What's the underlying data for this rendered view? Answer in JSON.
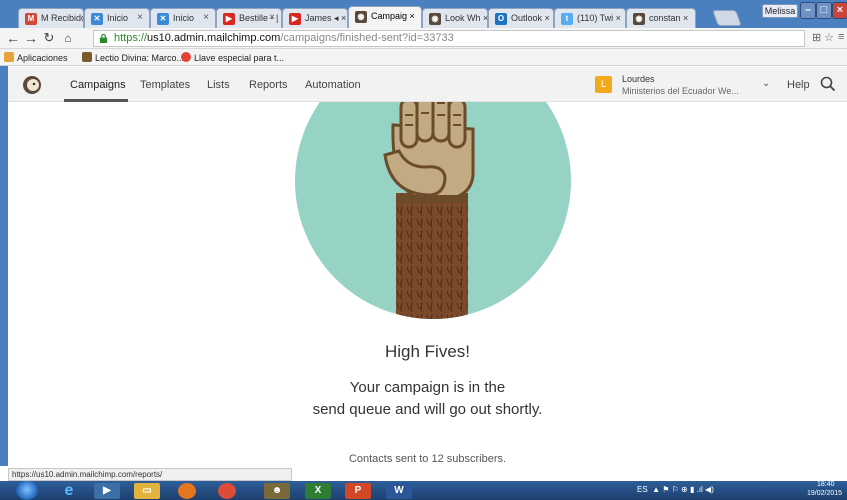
{
  "browser": {
    "tabs": [
      {
        "label": "M Recibidos ×",
        "fav": "M",
        "color": "#d44638"
      },
      {
        "label": "Inicio",
        "fav": "✕",
        "color": "#3b8ad9"
      },
      {
        "label": "Inicio",
        "fav": "✕",
        "color": "#3b8ad9"
      },
      {
        "label": "Bestille - |",
        "fav": "▶",
        "color": "#d8271c"
      },
      {
        "label": "James ◂ ×",
        "fav": "▶",
        "color": "#d8271c"
      },
      {
        "label": "Campaig ×",
        "fav": "◉",
        "color": "#5b4a3b"
      },
      {
        "label": "Look Wh ×",
        "fav": "◉",
        "color": "#5b4a3b"
      },
      {
        "label": "Outlook ×",
        "fav": "O",
        "color": "#1e73be"
      },
      {
        "label": "(110) Twi ×",
        "fav": "t",
        "color": "#55acee"
      },
      {
        "label": "constan ×",
        "fav": "◉",
        "color": "#5b4a3b"
      }
    ],
    "user_chip": "Melissa",
    "url": {
      "scheme": "https://",
      "host": "us10.admin.mailchimp.com",
      "path": "/campaigns/finished-sent?id=33733"
    },
    "bookmarks": [
      {
        "label": "Aplicaciones",
        "color": "#e8a23a"
      },
      {
        "label": "Lectio Divina: Marco...",
        "color": "#7b5b2d"
      },
      {
        "label": "Llave especial para t...",
        "color": "#e34234"
      }
    ],
    "status_url": "https://us10.admin.mailchimp.com/reports/"
  },
  "nav": {
    "items": [
      "Campaigns",
      "Templates",
      "Lists",
      "Reports",
      "Automation"
    ],
    "account_initial": "L",
    "account_name": "Lourdes",
    "account_org": "Ministerios del Ecuador We...",
    "help": "Help"
  },
  "content": {
    "title": "High Fives!",
    "message_line1": "Your campaign is in the",
    "message_line2": "send queue and will go out shortly.",
    "contacts": "Contacts sent to 12 subscribers."
  },
  "taskbar": {
    "tray_lang": "ES",
    "time": "18:40",
    "date": "19/02/2015"
  },
  "colors": {
    "hero_circle": "#97d3c4",
    "arm": "#7a4a2a",
    "hand": "#c2ab83",
    "taskbar": "#1d3f6e"
  }
}
